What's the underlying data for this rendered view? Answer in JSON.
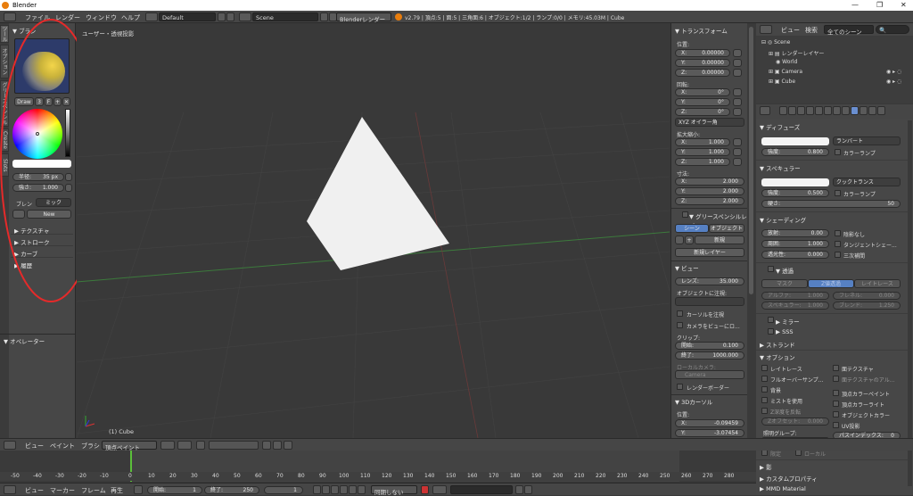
{
  "titlebar": {
    "title": "Blender"
  },
  "topbar": {
    "menus": [
      "ファイル",
      "レンダー",
      "ウィンドウ",
      "ヘルプ"
    ],
    "layout": "Default",
    "scene": "Scene",
    "engine": "Blenderレンダー",
    "stats": "v2.79 | 頂点:5 | 面:5 | 三角面:6 | オブジェクト:1/2 | ランプ:0/0 | メモリ:45.03M | Cube"
  },
  "toolshelf": {
    "tabs": [
      "ツール",
      "オプション",
      "グリースペンシル",
      "Create",
      "Slots"
    ],
    "brush_header": "▼ ブラシ",
    "brush_name": "Draw",
    "brush_users": "3",
    "brush_f": "F",
    "radius_label": "半径:",
    "radius_value": "35 px",
    "strength_label": "強さ:",
    "strength_value": "1.000",
    "blend_label": "ブレン",
    "blend_value": "ミック",
    "new_label": "New",
    "sections": [
      "テクスチャ",
      "ストローク",
      "カーブ",
      "履歴"
    ],
    "operator_header": "▼ オペレーター"
  },
  "viewport": {
    "label": "ユーザー・透視投影",
    "object_label": "(1) Cube"
  },
  "npanel": {
    "transform": "▼ トランスフォーム",
    "location": "位置:",
    "loc": [
      {
        "a": "X:",
        "v": "0.00000"
      },
      {
        "a": "Y:",
        "v": "0.00000"
      },
      {
        "a": "Z:",
        "v": "0.00000"
      }
    ],
    "rotation": "回転:",
    "rot": [
      {
        "a": "X:",
        "v": "0°"
      },
      {
        "a": "Y:",
        "v": "0°"
      },
      {
        "a": "Z:",
        "v": "0°"
      }
    ],
    "rotmode": "XYZ オイラー角",
    "scale": "拡大縮小:",
    "scl": [
      {
        "a": "X:",
        "v": "1.000"
      },
      {
        "a": "Y:",
        "v": "1.000"
      },
      {
        "a": "Z:",
        "v": "1.000"
      }
    ],
    "dimensions": "寸法:",
    "dim": [
      {
        "a": "X:",
        "v": "2.000"
      },
      {
        "a": "Y:",
        "v": "2.000"
      },
      {
        "a": "Z:",
        "v": "2.000"
      }
    ],
    "gp_header": "▼ グリースペンシルレイ",
    "gp_tab1": "シーン",
    "gp_tab2": "オブジェクト",
    "gp_new": "新規",
    "gp_new_layer": "新規レイヤー",
    "view_header": "▼ ビュー",
    "lens_label": "レンズ:",
    "lens_value": "35.000",
    "lock_obj": "オブジェクトに注視:",
    "lock_cursor": "カーソルを注視",
    "lock_camera": "カメラをビューにロ...",
    "clip": "クリップ:",
    "clip_start_label": "開始:",
    "clip_start": "0.100",
    "clip_end_label": "終了:",
    "clip_end": "1000.000",
    "local_camera": "ローカルカメラ:",
    "camera_name": "Camera",
    "render_border": "レンダーボーダー",
    "cursor_header": "▼ 3Dカーソル",
    "cursor_loc": "位置:",
    "cx_label": "X:",
    "cx": "-0.09459",
    "cy_label": "Y:",
    "cy": "-3.07454"
  },
  "outliner": {
    "view_menu": "ビュー",
    "search_menu": "検索",
    "scene_filter": "全てのシーン",
    "items": [
      {
        "name": "Scene"
      },
      {
        "name": "レンダーレイヤー"
      },
      {
        "name": "World"
      },
      {
        "name": "Camera"
      },
      {
        "name": "Cube"
      }
    ]
  },
  "props": {
    "diffuse": "▼ ディフューズ",
    "diffuse_shader": "ランバート",
    "intensity_label": "強度:",
    "diffuse_int": "0.800",
    "ramp": "カラーランプ",
    "specular": "▼ スペキュラー",
    "spec_shader": "クックトランス",
    "spec_int": "0.500",
    "spec_ramp": "カラーランプ",
    "hardness_label": "硬さ:",
    "hardness": "50",
    "shading": "▼ シェーディング",
    "emit_label": "放射:",
    "emit": "0.00",
    "shadeless": "陰影なし",
    "ambient_label": "周囲:",
    "ambient": "1.000",
    "tangent": "タンジェントシェー...",
    "translucency_label": "透光性:",
    "translucency": "0.000",
    "cubic": "三次補間",
    "transparency": "▼ 透過",
    "mask": "マスク",
    "ztrans": "Z値透過",
    "raytrace": "レイトレース",
    "alpha_label": "アルファ:",
    "alpha": "1.000",
    "fresnel_label": "フレネル:",
    "fresnel": "0.000",
    "spec2_label": "スペキュラー:",
    "spec2": "1.000",
    "blend_label": "ブレンド:",
    "blend": "1.250",
    "mirror": "▶ ミラー",
    "sss": "▶ SSS",
    "strand": "▶ ストランド",
    "options": "▼ オプション",
    "opt": [
      "レイトレース",
      "フルオーバーサンプ...",
      "背景",
      "ミストを使用",
      "Z深度を反転",
      "面テクスチャ",
      "面テクスチャのアル...",
      "頂点カラーペイント",
      "頂点カラーライト",
      "オブジェクトカラー",
      "UV投影"
    ],
    "zoffset_label": "Zオフセット:",
    "zoffset": "0.000",
    "light_group": "照明グループ:",
    "exclusive": "限定",
    "local": "ローカル",
    "pass_index_label": "パスインデックス:",
    "pass_index": "0",
    "shadow": "▶ 影",
    "custom": "▶ カスタムプロパティ",
    "mmd": "▶ MMD Material"
  },
  "bottombar": {
    "view": "ビュー",
    "paint": "ペイント",
    "brush": "ブラシ",
    "mode": "頂点ペイント"
  },
  "timeline": {
    "ticks": [
      "-50",
      "-40",
      "-30",
      "-20",
      "-10",
      "0",
      "10",
      "20",
      "30",
      "40",
      "50",
      "60",
      "70",
      "80",
      "90",
      "100",
      "110",
      "120",
      "130",
      "140",
      "150",
      "160",
      "170",
      "180",
      "190",
      "200",
      "210",
      "220",
      "230",
      "240",
      "250",
      "260",
      "270",
      "280"
    ]
  },
  "statusbar": {
    "view": "ビュー",
    "marker": "マーカー",
    "frame": "フレーム",
    "playback": "再生",
    "start_label": "開始:",
    "start": "1",
    "end_label": "終了:",
    "end": "250",
    "current": "1",
    "sync": "同期しない"
  }
}
